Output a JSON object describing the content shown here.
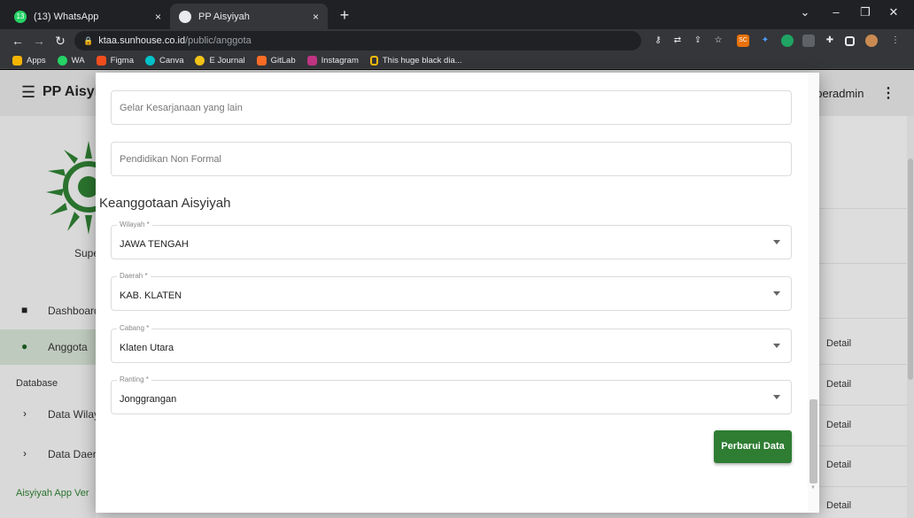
{
  "browser": {
    "tabs": [
      {
        "title": "(13) WhatsApp",
        "favicon_badge": "13",
        "active": false
      },
      {
        "title": "PP Aisyiyah",
        "active": true
      }
    ],
    "tab_close": "×",
    "new_tab": "+",
    "url_host": "ktaa.sunhouse.co.id",
    "url_path": "/public/anggota",
    "bookmarks": [
      {
        "label": "Apps",
        "color": "#f4b400"
      },
      {
        "label": "WA",
        "color": "#25d366"
      },
      {
        "label": "Figma",
        "color": "#f24e1e"
      },
      {
        "label": "Canva",
        "color": "#00c4cc"
      },
      {
        "label": "E Journal",
        "color": "#f5c518"
      },
      {
        "label": "GitLab",
        "color": "#fc6d26"
      },
      {
        "label": "Instagram",
        "color": "#c13584"
      },
      {
        "label": "This huge black dia...",
        "color": "#fbbc04"
      }
    ],
    "extension_badge": "SC"
  },
  "app": {
    "title": "PP Aisyiy",
    "user": "uperadmin",
    "sidebar": {
      "role": "Supe",
      "items": [
        {
          "label": "Dashboard",
          "active": false
        },
        {
          "label": "Anggota",
          "active": true
        }
      ],
      "database_header": "Database",
      "db_items": [
        {
          "label": "Data Wilay"
        },
        {
          "label": "Data Daer"
        }
      ],
      "footer": "Aisyiyah App Ver"
    },
    "table_action": "Detail",
    "accent": "#2e7d32"
  },
  "form": {
    "fields_top": [
      {
        "placeholder": "Gelar Kesarjanaan yang lain"
      },
      {
        "placeholder": "Pendidikan Non Formal"
      }
    ],
    "section_title": "Keanggotaan Aisyiyah",
    "selects": [
      {
        "label": "Wilayah *",
        "value": "JAWA TENGAH"
      },
      {
        "label": "Daerah *",
        "value": "KAB. KLATEN"
      },
      {
        "label": "Cabang *",
        "value": "Klaten Utara"
      },
      {
        "label": "Ranting *",
        "value": "Jonggrangan"
      }
    ],
    "submit_label": "Perbarui Data"
  }
}
